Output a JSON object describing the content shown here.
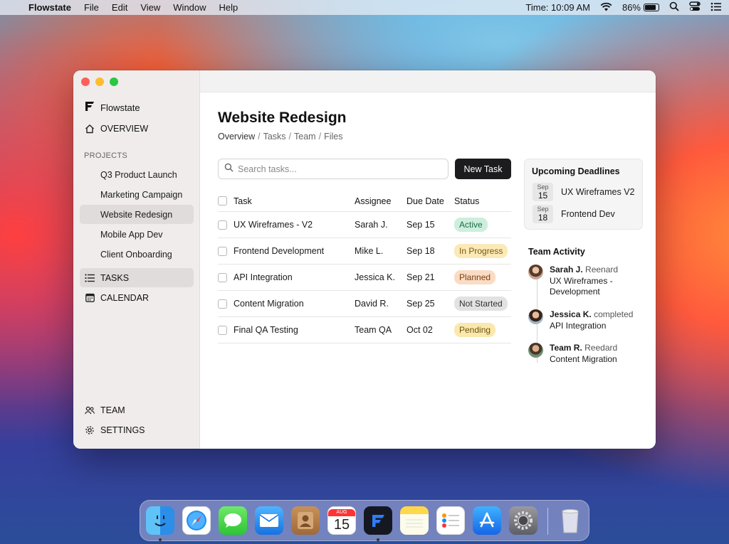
{
  "menubar": {
    "app_name": "Flowstate",
    "menus": [
      "File",
      "Edit",
      "View",
      "Window",
      "Help"
    ],
    "time": "Time: 10:09 AM",
    "battery": "86%",
    "battery_level": 0.86
  },
  "sidebar": {
    "brand": "Flowstate",
    "overview": "OVERVIEW",
    "projects_label": "PROJECTS",
    "projects": [
      {
        "label": "Q3 Product Launch"
      },
      {
        "label": "Marketing Campaign"
      },
      {
        "label": "Website Redesign",
        "active": true
      },
      {
        "label": "Mobile App Dev"
      },
      {
        "label": "Client Onboarding"
      }
    ],
    "tasks": "TASKS",
    "calendar": "CALENDAR",
    "team": "TEAM",
    "settings": "SETTINGS"
  },
  "main": {
    "title": "Website Redesign",
    "breadcrumbs": [
      "Overview",
      "Tasks",
      "Team",
      "Files"
    ],
    "search_placeholder": "Search tasks...",
    "new_task_label": "New Task",
    "table": {
      "headers": [
        "Task",
        "Assignee",
        "Due Date",
        "Status"
      ],
      "rows": [
        {
          "task": "UX Wireframes - V2",
          "assignee": "Sarah J.",
          "due": "Sep 15",
          "status": "Active"
        },
        {
          "task": "Frontend Development",
          "assignee": "Mike L.",
          "due": "Sep 18",
          "status": "In Progress"
        },
        {
          "task": "API Integration",
          "assignee": "Jessica K.",
          "due": "Sep 21",
          "status": "Planned"
        },
        {
          "task": "Content Migration",
          "assignee": "David R.",
          "due": "Sep 25",
          "status": "Not Started"
        },
        {
          "task": "Final QA Testing",
          "assignee": "Team QA",
          "due": "Oct 02",
          "status": "Pending"
        }
      ]
    }
  },
  "deadlines": {
    "title": "Upcoming Deadlines",
    "items": [
      {
        "month": "Sep",
        "day": "15",
        "label": "UX Wireframes V2"
      },
      {
        "month": "Sep",
        "day": "18",
        "label": "Frontend Dev"
      }
    ]
  },
  "activity": {
    "title": "Team Activity",
    "items": [
      {
        "who": "Sarah J.",
        "verb": "Reenard",
        "line2": "UX Wireframes -",
        "line3": "Development"
      },
      {
        "who": "Jessica K.",
        "verb": "completed",
        "line2": "API Integration",
        "line3": ""
      },
      {
        "who": "Team R.",
        "verb": "Reedard",
        "line2": "Content Migration",
        "line3": ""
      }
    ]
  },
  "dock": {
    "calendar_month": "AUG",
    "calendar_day": "15",
    "apps": [
      "finder-icon",
      "safari-icon",
      "messages-icon",
      "mail-icon",
      "contacts-icon",
      "calendar-icon",
      "flowstate-icon",
      "notes-icon",
      "reminders-icon",
      "app-store-icon",
      "system-settings-icon",
      "trash-icon"
    ]
  }
}
